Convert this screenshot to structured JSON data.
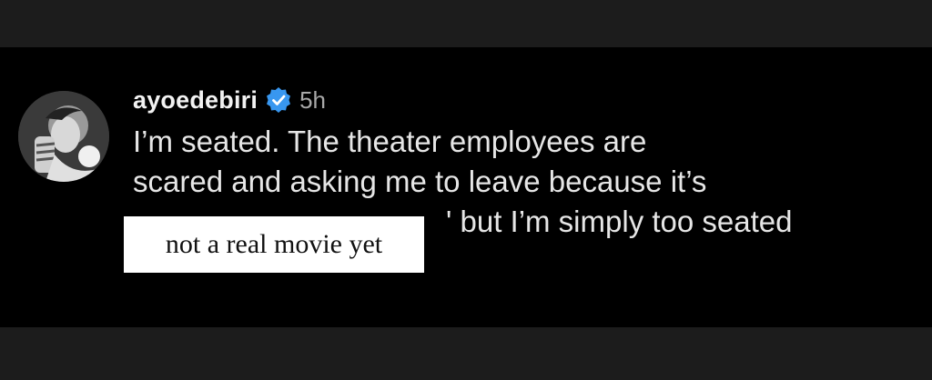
{
  "comment": {
    "username": "ayoedebiri",
    "verified_icon": "verified-badge-icon",
    "time": "5h",
    "lines": [
      "I’m seated. The theater employees are",
      "scared and asking me to leave because it’s",
      "but I’m simply too seated"
    ],
    "line3_prefix": "'"
  },
  "overlay": {
    "text": "not a real movie yet"
  },
  "colors": {
    "background": "#000000",
    "frame": "#1c1c1c",
    "verified": "#3897f0",
    "text": "#e6e6e6",
    "time": "#a8a8a8"
  }
}
